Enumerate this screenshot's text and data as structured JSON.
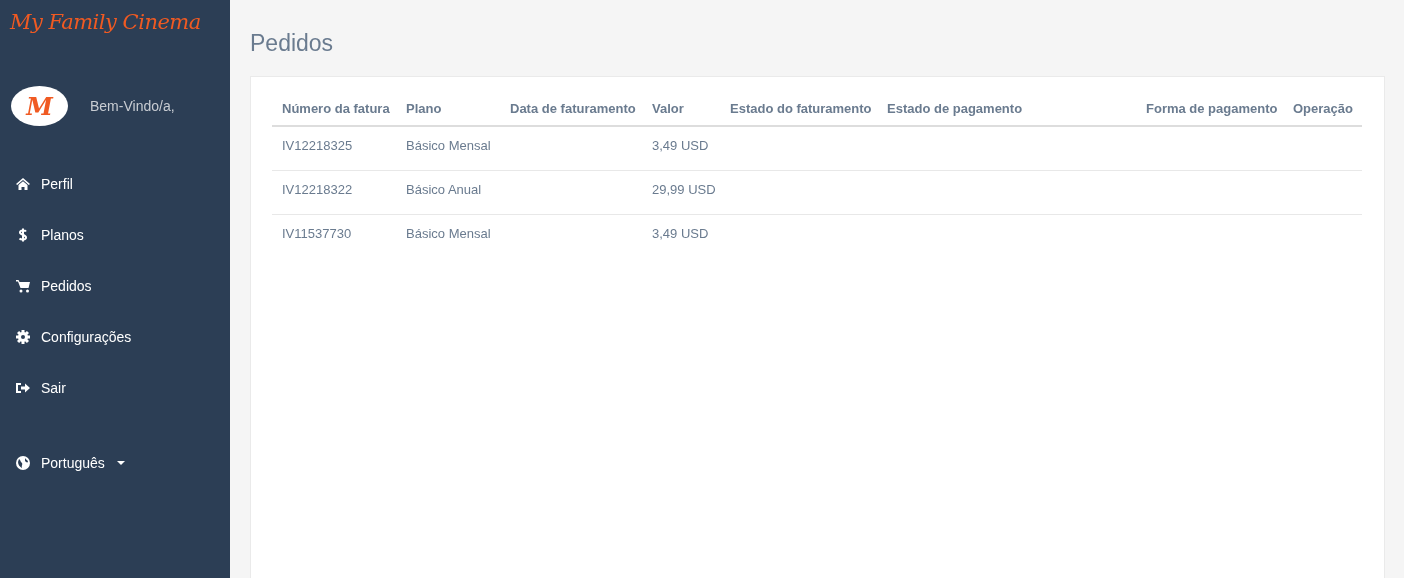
{
  "brand": {
    "logo": "My Family Cinema",
    "avatar_letter": "M",
    "greeting": "Bem-Vindo/a,"
  },
  "nav": [
    {
      "label": "Perfil"
    },
    {
      "label": "Planos"
    },
    {
      "label": "Pedidos"
    },
    {
      "label": "Configurações"
    },
    {
      "label": "Sair"
    }
  ],
  "language": {
    "label": "Português"
  },
  "page_title": "Pedidos",
  "table": {
    "columns": [
      "Número da fatura",
      "Plano",
      "Data de faturamento",
      "Valor",
      "Estado do faturamento",
      "Estado de pagamento",
      "Forma de pagamento",
      "Operação"
    ],
    "rows": [
      {
        "invoice": "IV12218325",
        "plan": "Básico Mensal",
        "value": "3,49 USD"
      },
      {
        "invoice": "IV12218322",
        "plan": "Básico Anual",
        "value": "29,99 USD"
      },
      {
        "invoice": "IV11537730",
        "plan": "Básico Mensal",
        "value": "3,49 USD"
      }
    ]
  }
}
